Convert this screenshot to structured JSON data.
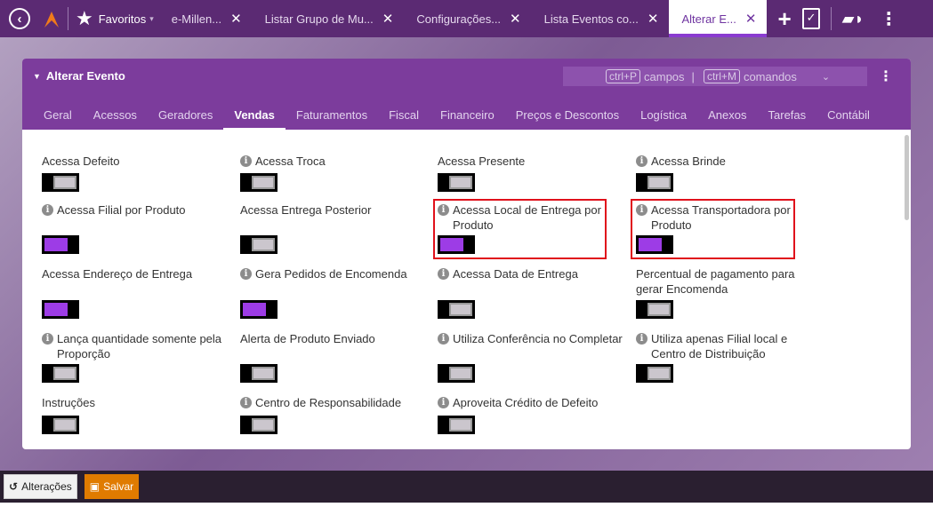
{
  "topbar": {
    "favorites_label": "Favoritos",
    "tabs": [
      {
        "label": "e-Millen..."
      },
      {
        "label": "Listar Grupo de Mu..."
      },
      {
        "label": "Configurações..."
      },
      {
        "label": "Lista Eventos co..."
      },
      {
        "label": "Alterar E..."
      }
    ]
  },
  "panel": {
    "title": "Alterar Evento",
    "shortcut_fields_key": "ctrl+P",
    "shortcut_fields_label": "campos",
    "shortcut_commands_key": "ctrl+M",
    "shortcut_commands_label": "comandos",
    "subtabs": [
      "Geral",
      "Acessos",
      "Geradores",
      "Vendas",
      "Faturamentos",
      "Fiscal",
      "Financeiro",
      "Preços e Descontos",
      "Logística",
      "Anexos",
      "Tarefas",
      "Contábil"
    ],
    "active_subtab": "Vendas"
  },
  "fields": [
    {
      "label": "Acessa Defeito",
      "info": false,
      "on": false
    },
    {
      "label": "Acessa Troca",
      "info": true,
      "on": false
    },
    {
      "label": "Acessa Presente",
      "info": false,
      "on": false
    },
    {
      "label": "Acessa Brinde",
      "info": true,
      "on": false
    },
    {
      "label": "Acessa Filial por Produto",
      "info": true,
      "on": true
    },
    {
      "label": "Acessa Entrega Posterior",
      "info": false,
      "on": false
    },
    {
      "label": "Acessa Local de Entrega por Produto",
      "info": true,
      "on": true
    },
    {
      "label": "Acessa Transportadora por Produto",
      "info": true,
      "on": true
    },
    {
      "label": "Acessa Endereço de Entrega",
      "info": false,
      "on": true
    },
    {
      "label": "Gera Pedidos de Encomenda",
      "info": true,
      "on": true
    },
    {
      "label": "Acessa Data de Entrega",
      "info": true,
      "on": false
    },
    {
      "label": "Percentual de pagamento para gerar Encomenda",
      "info": false,
      "on": false
    },
    {
      "label": "Lança quantidade somente pela Proporção",
      "info": true,
      "on": false
    },
    {
      "label": "Alerta de Produto Enviado",
      "info": false,
      "on": false
    },
    {
      "label": "Utiliza Conferência no Completar",
      "info": true,
      "on": false
    },
    {
      "label": "Utiliza apenas Filial local e Centro de Distribuição",
      "info": true,
      "on": false
    },
    {
      "label": "Instruções",
      "info": false,
      "on": false
    },
    {
      "label": "Centro de Responsabilidade",
      "info": true,
      "on": false
    },
    {
      "label": "Aproveita Crédito de Defeito",
      "info": true,
      "on": false
    }
  ],
  "footer": {
    "changes_label": "Alterações",
    "save_label": "Salvar"
  },
  "colors": {
    "topbar": "#5b2a73",
    "panel_header": "#7c3c9c",
    "toggle_on": "#9d3ce6",
    "highlight": "#e0111b",
    "save_button": "#e07b00"
  }
}
